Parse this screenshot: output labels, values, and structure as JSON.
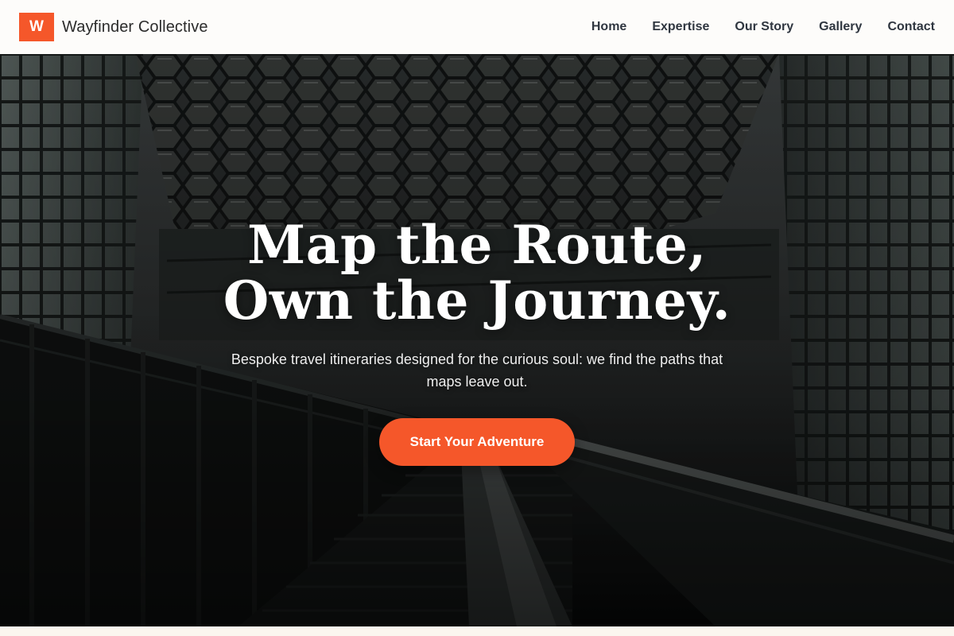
{
  "brand": {
    "logo_letter": "W",
    "name": "Wayfinder Collective"
  },
  "nav": {
    "items": [
      {
        "label": "Home"
      },
      {
        "label": "Expertise"
      },
      {
        "label": "Our Story"
      },
      {
        "label": "Gallery"
      },
      {
        "label": "Contact"
      }
    ]
  },
  "hero": {
    "title_line1": "Map the Route,",
    "title_line2": "Own the Journey.",
    "subtitle": "Bespoke travel itineraries designed for the curious soul: we find the paths that maps leave out.",
    "cta_label": "Start Your Adventure",
    "background": "dark-architectural-stairway-photo"
  },
  "colors": {
    "accent": "#f5572a",
    "nav_background": "#fdfcfa",
    "nav_text": "#2f3640",
    "page_background": "#fbf6ef"
  }
}
